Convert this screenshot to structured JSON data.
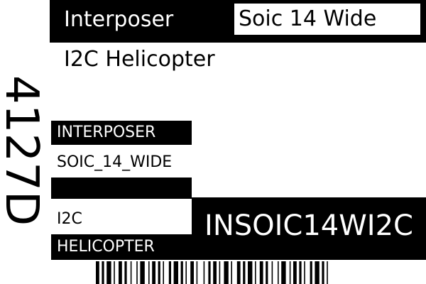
{
  "header": {
    "category": "Interposer",
    "package": "Soic 14 Wide"
  },
  "title": "I2C Helicopter",
  "vertical_id": "4127D",
  "tags": {
    "category": "INTERPOSER",
    "package": "SOIC_14_WIDE",
    "bus": "I2C",
    "name": "HELICOPTER"
  },
  "code": "INSOIC14WI2C",
  "colors": {
    "background": "#ffffff",
    "foreground": "#000000"
  }
}
